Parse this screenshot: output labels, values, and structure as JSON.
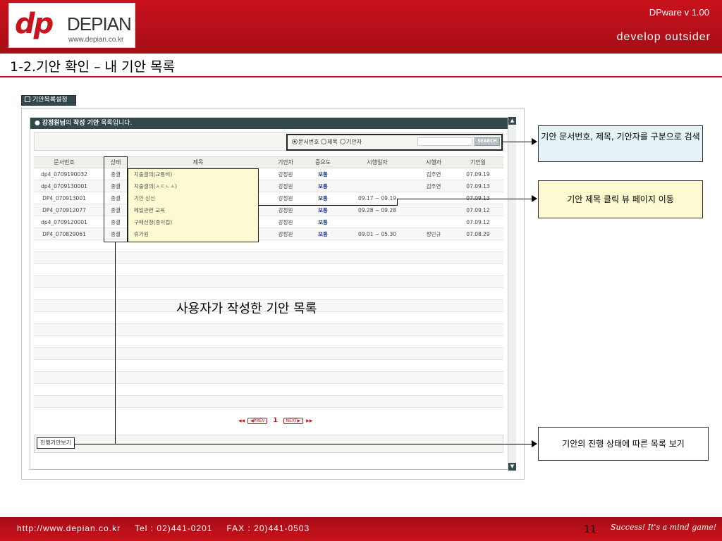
{
  "header": {
    "logo_mark": "dp",
    "logo_name": "DEPIAN",
    "logo_url": "www.depian.co.kr",
    "version": "DPware v 1.00",
    "slogan": "develop outsider"
  },
  "slide_title": "1-2.기안 확인 – 내 기안 목록",
  "panel": {
    "tab_label": "기안목록설정",
    "list_header_user": "강정원님",
    "list_header_mid": "의 ",
    "list_header_bold": "작성 기안",
    "list_header_tail": " 목록입니다."
  },
  "search": {
    "options": [
      "문서번호",
      "제목",
      "기안자"
    ],
    "selected": "문서번호",
    "button": "SEARCH",
    "input_value": ""
  },
  "table": {
    "columns": [
      "문서번호",
      "상태",
      "제목",
      "기안자",
      "중요도",
      "시행일자",
      "시행자",
      "기안일"
    ],
    "rows": [
      {
        "doc": "dp4_0709190032",
        "status": "종결",
        "title": "지출결의(교통비)",
        "author": "강정원",
        "priority": "보통",
        "exec_date": "",
        "executor": "김주연",
        "date": "07.09.19"
      },
      {
        "doc": "dp4_0709130001",
        "status": "종결",
        "title": "지출결의(ㅅㄷㄴㅅ)",
        "author": "강정원",
        "priority": "보통",
        "exec_date": "",
        "executor": "김주연",
        "date": "07.09.13"
      },
      {
        "doc": "DP4_070913001",
        "status": "종결",
        "title": "기안 상신",
        "author": "강정원",
        "priority": "보통",
        "exec_date": "09.17 ~ 09.19",
        "executor": "",
        "date": "07.09.13"
      },
      {
        "doc": "DP4_070912077",
        "status": "종결",
        "title": "메일관련 교육",
        "author": "강정원",
        "priority": "보통",
        "exec_date": "09.28 ~ 09.28",
        "executor": "",
        "date": "07.09.12"
      },
      {
        "doc": "dp4_0709120001",
        "status": "종결",
        "title": "구매신청(종이컵)",
        "author": "강정원",
        "priority": "보통",
        "exec_date": "",
        "executor": "",
        "date": "07.09.12"
      },
      {
        "doc": "DP4_070829061",
        "status": "종결",
        "title": "휴가원",
        "author": "강정원",
        "priority": "보통",
        "exec_date": "09.01 ~ 05.30",
        "executor": "정민규",
        "date": "07.08.29"
      }
    ]
  },
  "pager": {
    "prev": "PREV",
    "current": "1",
    "next": "NEXT",
    "first": "◀◀",
    "last": "▶▶"
  },
  "progress_button": "진행기안보기",
  "centre_caption": "사용자가 작성한 기안 목록",
  "callouts": {
    "search": "기안 문서번호, 제목, 기안자를 구분으로 검색",
    "title_click": "기안 제목 클릭 뷰 페이지 이동",
    "progress": "기안의 진행 상태에 따른 목록 보기"
  },
  "footer": {
    "url": "http://www.depian.co.kr",
    "tel": "Tel : 02)441-0201",
    "fax": "FAX : 20)441-0503",
    "page_number": "11",
    "slogan": "Success! It's a mind game!"
  },
  "colors": {
    "brand_red": "#c8121c",
    "panel_dark": "#32484d",
    "callout_blue": "#e6f3f6",
    "callout_yellow": "#fbfad0"
  }
}
